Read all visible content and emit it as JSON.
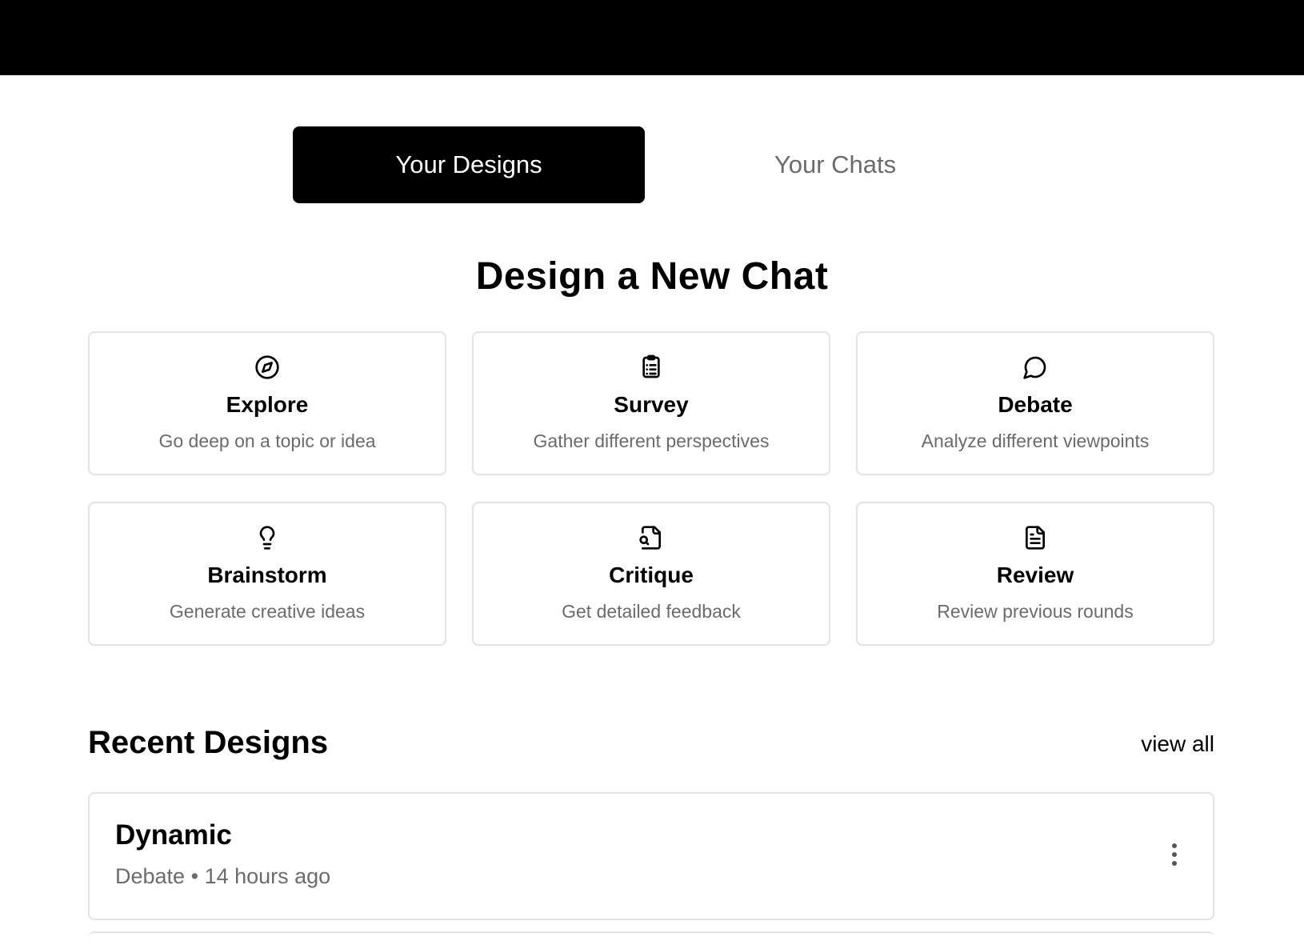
{
  "tabs": [
    {
      "label": "Your Designs",
      "active": true
    },
    {
      "label": "Your Chats",
      "active": false
    }
  ],
  "heading": "Design a New Chat",
  "cards": [
    {
      "title": "Explore",
      "description": "Go deep on a topic or idea",
      "icon": "compass-icon"
    },
    {
      "title": "Survey",
      "description": "Gather different perspectives",
      "icon": "clipboard-list-icon"
    },
    {
      "title": "Debate",
      "description": "Analyze different viewpoints",
      "icon": "message-circle-icon"
    },
    {
      "title": "Brainstorm",
      "description": "Generate creative ideas",
      "icon": "lightbulb-icon"
    },
    {
      "title": "Critique",
      "description": "Get detailed feedback",
      "icon": "file-search-icon"
    },
    {
      "title": "Review",
      "description": "Review previous rounds",
      "icon": "file-text-icon"
    }
  ],
  "recent": {
    "title": "Recent Designs",
    "view_all": "view all",
    "items": [
      {
        "name": "Dynamic",
        "type": "Debate",
        "separator": "•",
        "time": "14 hours ago"
      }
    ]
  },
  "colors": {
    "accent": "#000000",
    "muted_text": "#6b6b6b",
    "border": "#e3e3e3"
  }
}
